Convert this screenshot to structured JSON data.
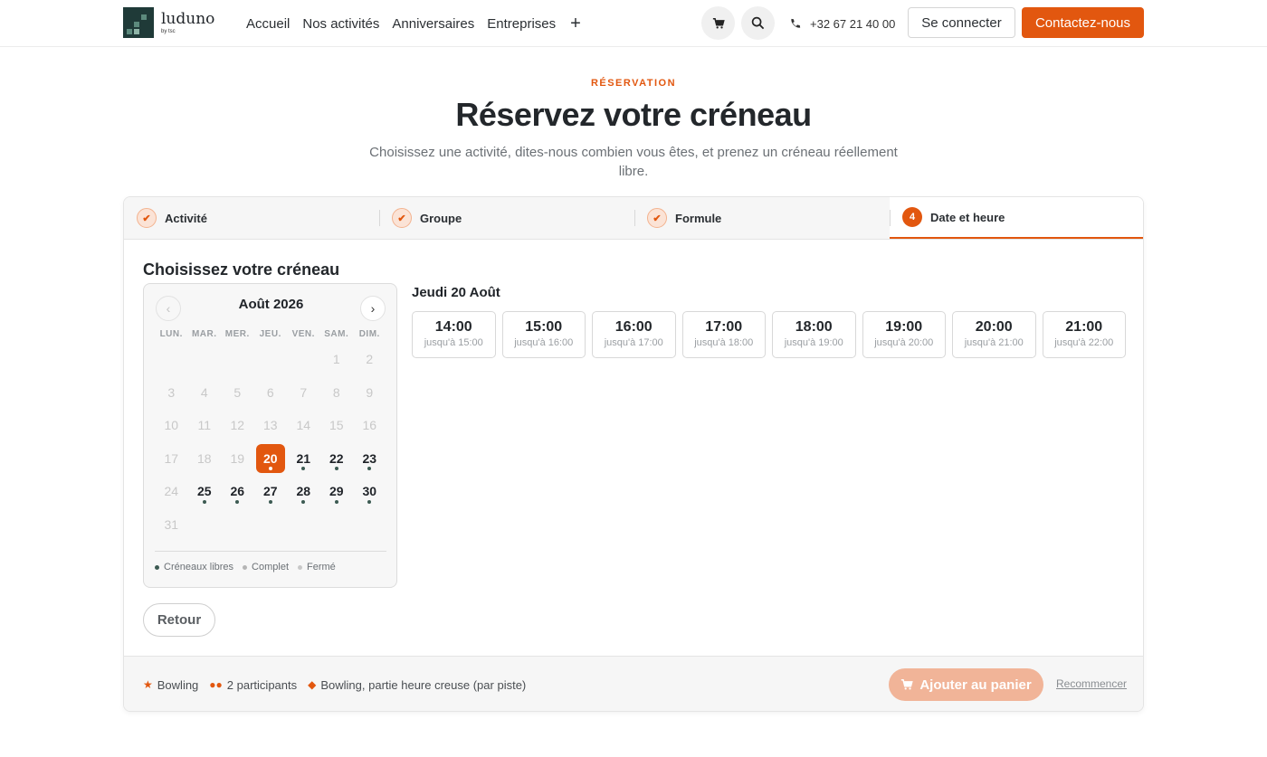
{
  "header": {
    "logo_name": "luduno",
    "logo_sub": "by tsc",
    "menu": [
      "Accueil",
      "Nos activités",
      "Anniversaires",
      "Entreprises"
    ],
    "menu_more": "+",
    "phone": "+32 67 21 40 00",
    "login_label": "Se connecter",
    "contact_label": "Contactez-nous"
  },
  "hero": {
    "eyebrow": "RÉSERVATION",
    "title": "Réservez votre créneau",
    "subtitle": "Choisissez une activité, dites-nous combien vous êtes, et prenez un créneau réellement libre."
  },
  "steps": [
    {
      "label": "Activité",
      "state": "done"
    },
    {
      "label": "Groupe",
      "state": "done"
    },
    {
      "label": "Formule",
      "state": "done"
    },
    {
      "label": "Date et heure",
      "state": "active",
      "number": "4"
    }
  ],
  "section_title": "Choisissez votre créneau",
  "calendar": {
    "month": "Août 2026",
    "weekdays": [
      "LUN.",
      "MAR.",
      "MER.",
      "JEU.",
      "VEN.",
      "SAM.",
      "DIM."
    ],
    "days": [
      {
        "d": "",
        "s": "empty"
      },
      {
        "d": "",
        "s": "empty"
      },
      {
        "d": "",
        "s": "empty"
      },
      {
        "d": "",
        "s": "empty"
      },
      {
        "d": "",
        "s": "empty"
      },
      {
        "d": "1",
        "s": "off"
      },
      {
        "d": "2",
        "s": "off"
      },
      {
        "d": "3",
        "s": "off"
      },
      {
        "d": "4",
        "s": "off"
      },
      {
        "d": "5",
        "s": "off"
      },
      {
        "d": "6",
        "s": "off"
      },
      {
        "d": "7",
        "s": "off"
      },
      {
        "d": "8",
        "s": "off"
      },
      {
        "d": "9",
        "s": "off"
      },
      {
        "d": "10",
        "s": "off"
      },
      {
        "d": "11",
        "s": "off"
      },
      {
        "d": "12",
        "s": "off"
      },
      {
        "d": "13",
        "s": "off"
      },
      {
        "d": "14",
        "s": "off"
      },
      {
        "d": "15",
        "s": "off"
      },
      {
        "d": "16",
        "s": "off"
      },
      {
        "d": "17",
        "s": "off"
      },
      {
        "d": "18",
        "s": "off"
      },
      {
        "d": "19",
        "s": "off"
      },
      {
        "d": "20",
        "s": "sel"
      },
      {
        "d": "21",
        "s": "avail"
      },
      {
        "d": "22",
        "s": "avail"
      },
      {
        "d": "23",
        "s": "avail"
      },
      {
        "d": "24",
        "s": "off"
      },
      {
        "d": "25",
        "s": "avail"
      },
      {
        "d": "26",
        "s": "avail"
      },
      {
        "d": "27",
        "s": "avail"
      },
      {
        "d": "28",
        "s": "avail"
      },
      {
        "d": "29",
        "s": "avail"
      },
      {
        "d": "30",
        "s": "avail"
      },
      {
        "d": "31",
        "s": "off"
      }
    ],
    "legend": [
      {
        "label": "Créneaux libres",
        "color": "#3c5a52"
      },
      {
        "label": "Complet",
        "color": "#b5b5b5"
      },
      {
        "label": "Fermé",
        "color": "#c8c8c8"
      }
    ]
  },
  "selected_date": "Jeudi 20 Août",
  "slots": [
    {
      "time": "14:00",
      "until": "jusqu'à 15:00"
    },
    {
      "time": "15:00",
      "until": "jusqu'à 16:00"
    },
    {
      "time": "16:00",
      "until": "jusqu'à 17:00"
    },
    {
      "time": "17:00",
      "until": "jusqu'à 18:00"
    },
    {
      "time": "18:00",
      "until": "jusqu'à 19:00"
    },
    {
      "time": "19:00",
      "until": "jusqu'à 20:00"
    },
    {
      "time": "20:00",
      "until": "jusqu'à 21:00"
    },
    {
      "time": "21:00",
      "until": "jusqu'à 22:00"
    }
  ],
  "back_label": "Retour",
  "summary": {
    "activity": "Bowling",
    "group": "2 participants",
    "formula": "Bowling, partie heure creuse (par piste)"
  },
  "add_to_cart_label": "Ajouter au panier",
  "restart_label": "Recommencer",
  "colors": {
    "accent": "#e2570f",
    "available": "#3c5a52"
  }
}
